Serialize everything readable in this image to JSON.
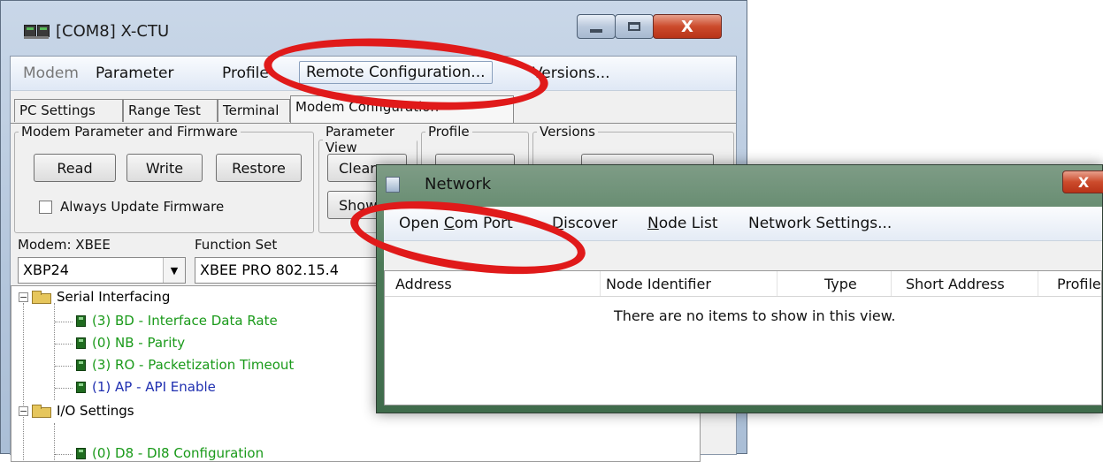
{
  "main_window": {
    "title": "[COM8] X-CTU",
    "menu": [
      "Modem",
      "Parameter",
      "Profile",
      "Remote Configuration...",
      "Versions..."
    ],
    "tabs": [
      "PC Settings",
      "Range Test",
      "Terminal",
      "Modem Configuration"
    ],
    "groups": {
      "modem_param_fw": "Modem Parameter and Firmware",
      "param_view": "Parameter View",
      "profile": "Profile",
      "versions": "Versions"
    },
    "buttons": {
      "read": "Read",
      "write": "Write",
      "restore": "Restore",
      "clear": "Clear",
      "show": "Show"
    },
    "always_update_label": "Always Update Firmware",
    "modem_label": "Modem: XBEE",
    "function_set_label": "Function Set",
    "modem_value": "XBP24",
    "function_set_value": "XBEE PRO 802.15.4",
    "tree": [
      {
        "type": "folder",
        "label": "Serial Interfacing"
      },
      {
        "type": "param",
        "label": "(3) BD - Interface Data Rate",
        "color": "#1a9a1a"
      },
      {
        "type": "param",
        "label": "(0) NB - Parity",
        "color": "#1a9a1a"
      },
      {
        "type": "param",
        "label": "(3) RO - Packetization Timeout",
        "color": "#1a9a1a"
      },
      {
        "type": "param",
        "label": "(1) AP - API Enable",
        "color": "#1f2fb0"
      },
      {
        "type": "folder",
        "label": "I/O Settings"
      },
      {
        "type": "param",
        "label": "(0) D8 - DI8 Configuration",
        "color": "#1a9a1a"
      }
    ]
  },
  "network_window": {
    "title": "Network",
    "close_glyph": "X",
    "menu": {
      "open_com_port": {
        "pre": "Open ",
        "u": "C",
        "post": "om Port"
      },
      "discover": {
        "pre": "",
        "u": "D",
        "post": "iscover"
      },
      "node_list": {
        "pre": "",
        "u": "N",
        "post": "ode List"
      },
      "network_settings": "Network Settings..."
    },
    "columns": [
      "Address",
      "Node Identifier",
      "Type",
      "Short Address",
      "Profile"
    ],
    "empty_message": "There are no items to show in this view."
  },
  "colors": {
    "highlight": "#e01a1a",
    "param_green": "#1a9a1a",
    "param_blue": "#1f2fb0"
  }
}
